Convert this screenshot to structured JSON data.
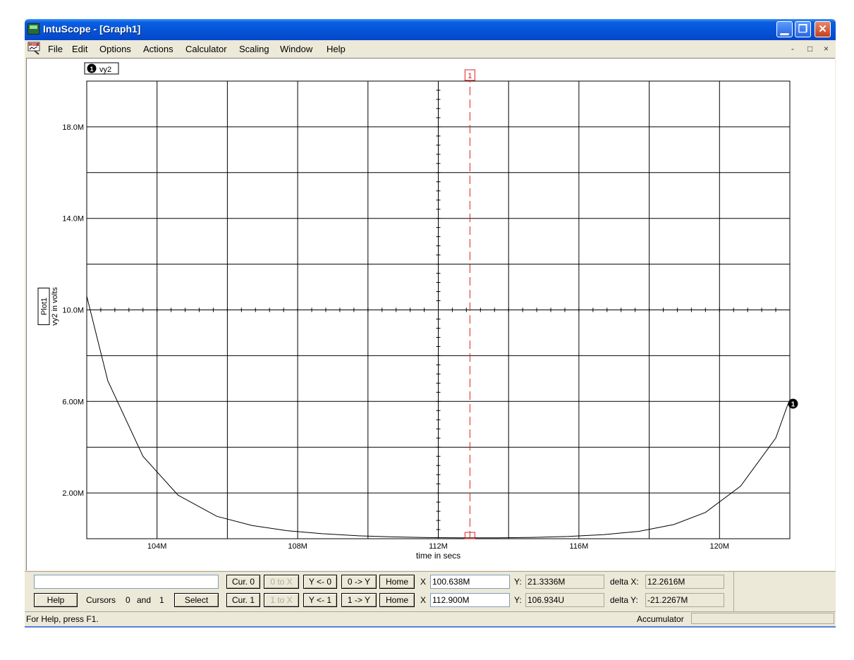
{
  "window": {
    "title": "IntuScope - [Graph1]"
  },
  "menu": [
    "File",
    "Edit",
    "Options",
    "Actions",
    "Calculator",
    "Scaling",
    "Window",
    "Help"
  ],
  "mdi_controls": {
    "minimize": "-",
    "restore": "□",
    "close": "×"
  },
  "chart_data": {
    "type": "line",
    "series": [
      {
        "name": "vy2",
        "x": [
          102.0,
          102.6,
          103.6,
          104.6,
          105.7,
          106.7,
          107.7,
          108.7,
          109.7,
          110.7,
          111.7,
          112.7,
          113.7,
          114.7,
          115.7,
          116.7,
          117.7,
          118.7,
          119.6,
          120.6,
          121.6,
          121.95
        ],
        "y": [
          10.6,
          6.9,
          3.6,
          1.9,
          0.98,
          0.58,
          0.35,
          0.22,
          0.13,
          0.08,
          0.05,
          0.04,
          0.04,
          0.06,
          0.1,
          0.18,
          0.32,
          0.62,
          1.15,
          2.3,
          4.4,
          5.9
        ]
      }
    ],
    "xlabel": "time in secs",
    "ylabel": "vy2 in volts",
    "plot_label": "Plot1",
    "legend": "vy2",
    "xlim": [
      102,
      122
    ],
    "ylim": [
      0,
      20
    ],
    "x_ticks": [
      104,
      108,
      112,
      116,
      120
    ],
    "x_tick_labels": [
      "104M",
      "108M",
      "112M",
      "116M",
      "120M"
    ],
    "y_ticks": [
      2,
      6,
      10,
      14,
      18
    ],
    "y_tick_labels": [
      "2.00M",
      "6.00M",
      "10.0M",
      "14.0M",
      "18.0M"
    ],
    "grid": true,
    "cursor": {
      "label": "1",
      "x": 112.9
    },
    "trace_marker": "1"
  },
  "controls": {
    "help": "Help",
    "cursors_text": "Cursors",
    "cursor_a": "0",
    "and_text": "and",
    "cursor_b": "1",
    "select": "Select",
    "cur0": "Cur. 0",
    "cur1": "Cur. 1",
    "zero_to_x": "0 to X",
    "one_to_x": "1 to X",
    "y_from_0": "Y <- 0",
    "y_from_1": "Y <- 1",
    "zero_to_y": "0 -> Y",
    "one_to_y": "1 -> Y",
    "home": "Home",
    "x_label": "X",
    "y_label": "Y:",
    "x0": "100.638M",
    "x1": "112.900M",
    "y0": "21.3336M",
    "y1": "106.934U",
    "delta_x_label": "delta X:",
    "delta_y_label": "delta Y:",
    "delta_x": "12.2616M",
    "delta_y": "-21.2267M",
    "expression": ""
  },
  "status": {
    "help_text": "For Help, press F1.",
    "accumulator": "Accumulator"
  }
}
